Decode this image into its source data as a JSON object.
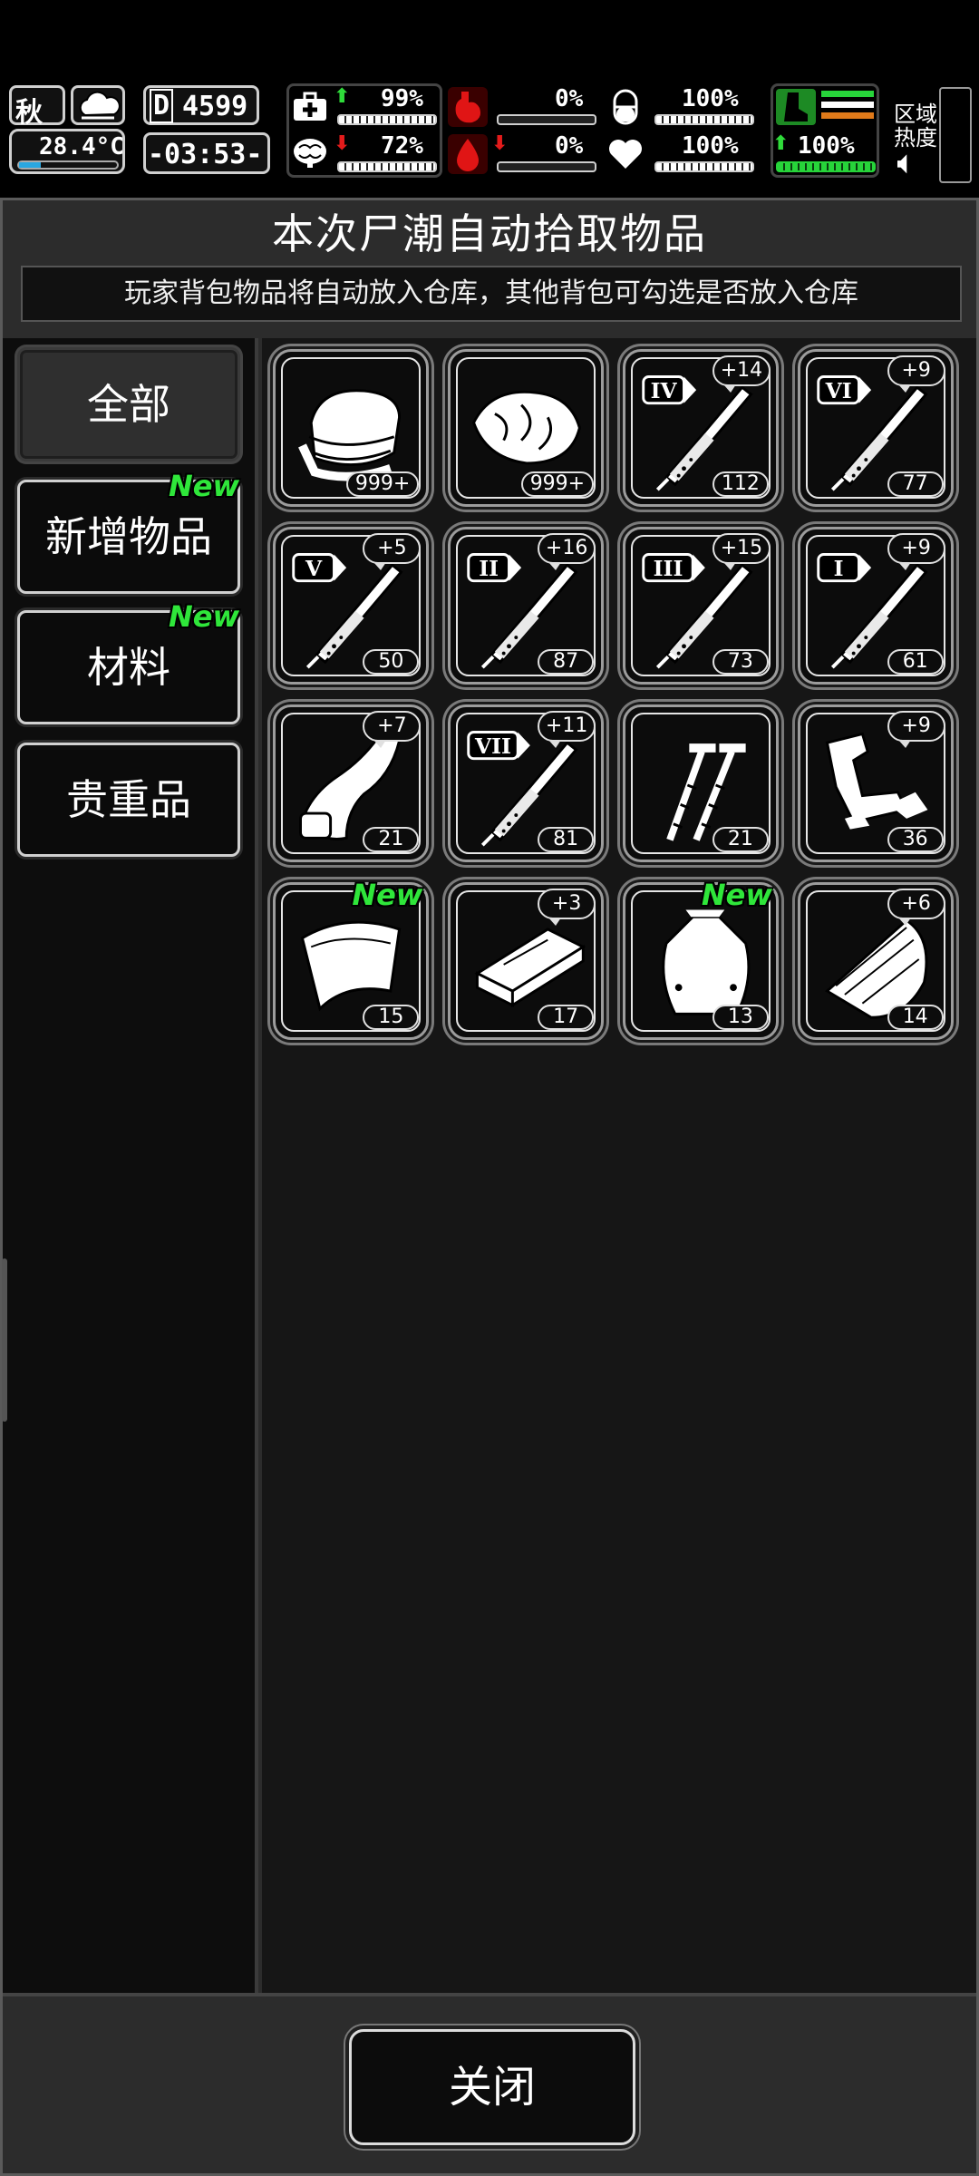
{
  "hud": {
    "season": "秋",
    "temperature": "28.4°C",
    "day": "4599",
    "day_prefix": "D",
    "clock": "-03:53-",
    "stats": {
      "health": "99%",
      "sanity": "72%",
      "hunger": "0%",
      "bleeding": "0%",
      "medicine": "100%",
      "heart": "100%",
      "stamina": "100%"
    },
    "zone_heat_label": "区域\n热度",
    "zone_heat_line1": "区域",
    "zone_heat_line2": "热度"
  },
  "panel": {
    "title": "本次尸潮自动拾取物品",
    "subtitle": "玩家背包物品将自动放入仓库，其他背包可勾选是否放入仓库"
  },
  "categories": [
    {
      "label": "全部",
      "active": true,
      "new": ""
    },
    {
      "label": "新增物品",
      "active": false,
      "new": "New"
    },
    {
      "label": "材料",
      "active": false,
      "new": "New"
    },
    {
      "label": "贵重品",
      "active": false,
      "new": ""
    }
  ],
  "items": [
    {
      "icon": "cloth-icon",
      "count": "999+",
      "plus": "",
      "new": ""
    },
    {
      "icon": "meat-icon",
      "count": "999+",
      "plus": "",
      "new": ""
    },
    {
      "icon": "syringe-iv-icon",
      "roman": "IV",
      "count": "112",
      "plus": "+14",
      "new": ""
    },
    {
      "icon": "syringe-vi-icon",
      "roman": "VI",
      "count": "77",
      "plus": "+9",
      "new": ""
    },
    {
      "icon": "syringe-v-icon",
      "roman": "V",
      "count": "50",
      "plus": "+5",
      "new": ""
    },
    {
      "icon": "syringe-ii-icon",
      "roman": "II",
      "count": "87",
      "plus": "+16",
      "new": ""
    },
    {
      "icon": "syringe-iii-icon",
      "roman": "III",
      "count": "73",
      "plus": "+15",
      "new": ""
    },
    {
      "icon": "syringe-i-icon",
      "roman": "I",
      "count": "61",
      "plus": "+9",
      "new": ""
    },
    {
      "icon": "leather-icon",
      "count": "21",
      "plus": "+7",
      "new": ""
    },
    {
      "icon": "syringe-vii-icon",
      "roman": "VII",
      "count": "81",
      "plus": "+11",
      "new": ""
    },
    {
      "icon": "screws-icon",
      "count": "21",
      "plus": "",
      "new": ""
    },
    {
      "icon": "scrap-metal-icon",
      "count": "36",
      "plus": "+9",
      "new": ""
    },
    {
      "icon": "fabric-sheet-icon",
      "count": "15",
      "plus": "",
      "new": "New"
    },
    {
      "icon": "wood-plank-icon",
      "count": "17",
      "plus": "+3",
      "new": ""
    },
    {
      "icon": "pouch-icon",
      "count": "13",
      "plus": "",
      "new": "New"
    },
    {
      "icon": "log-icon",
      "count": "14",
      "plus": "+6",
      "new": ""
    }
  ],
  "footer": {
    "close_label": "关闭"
  }
}
